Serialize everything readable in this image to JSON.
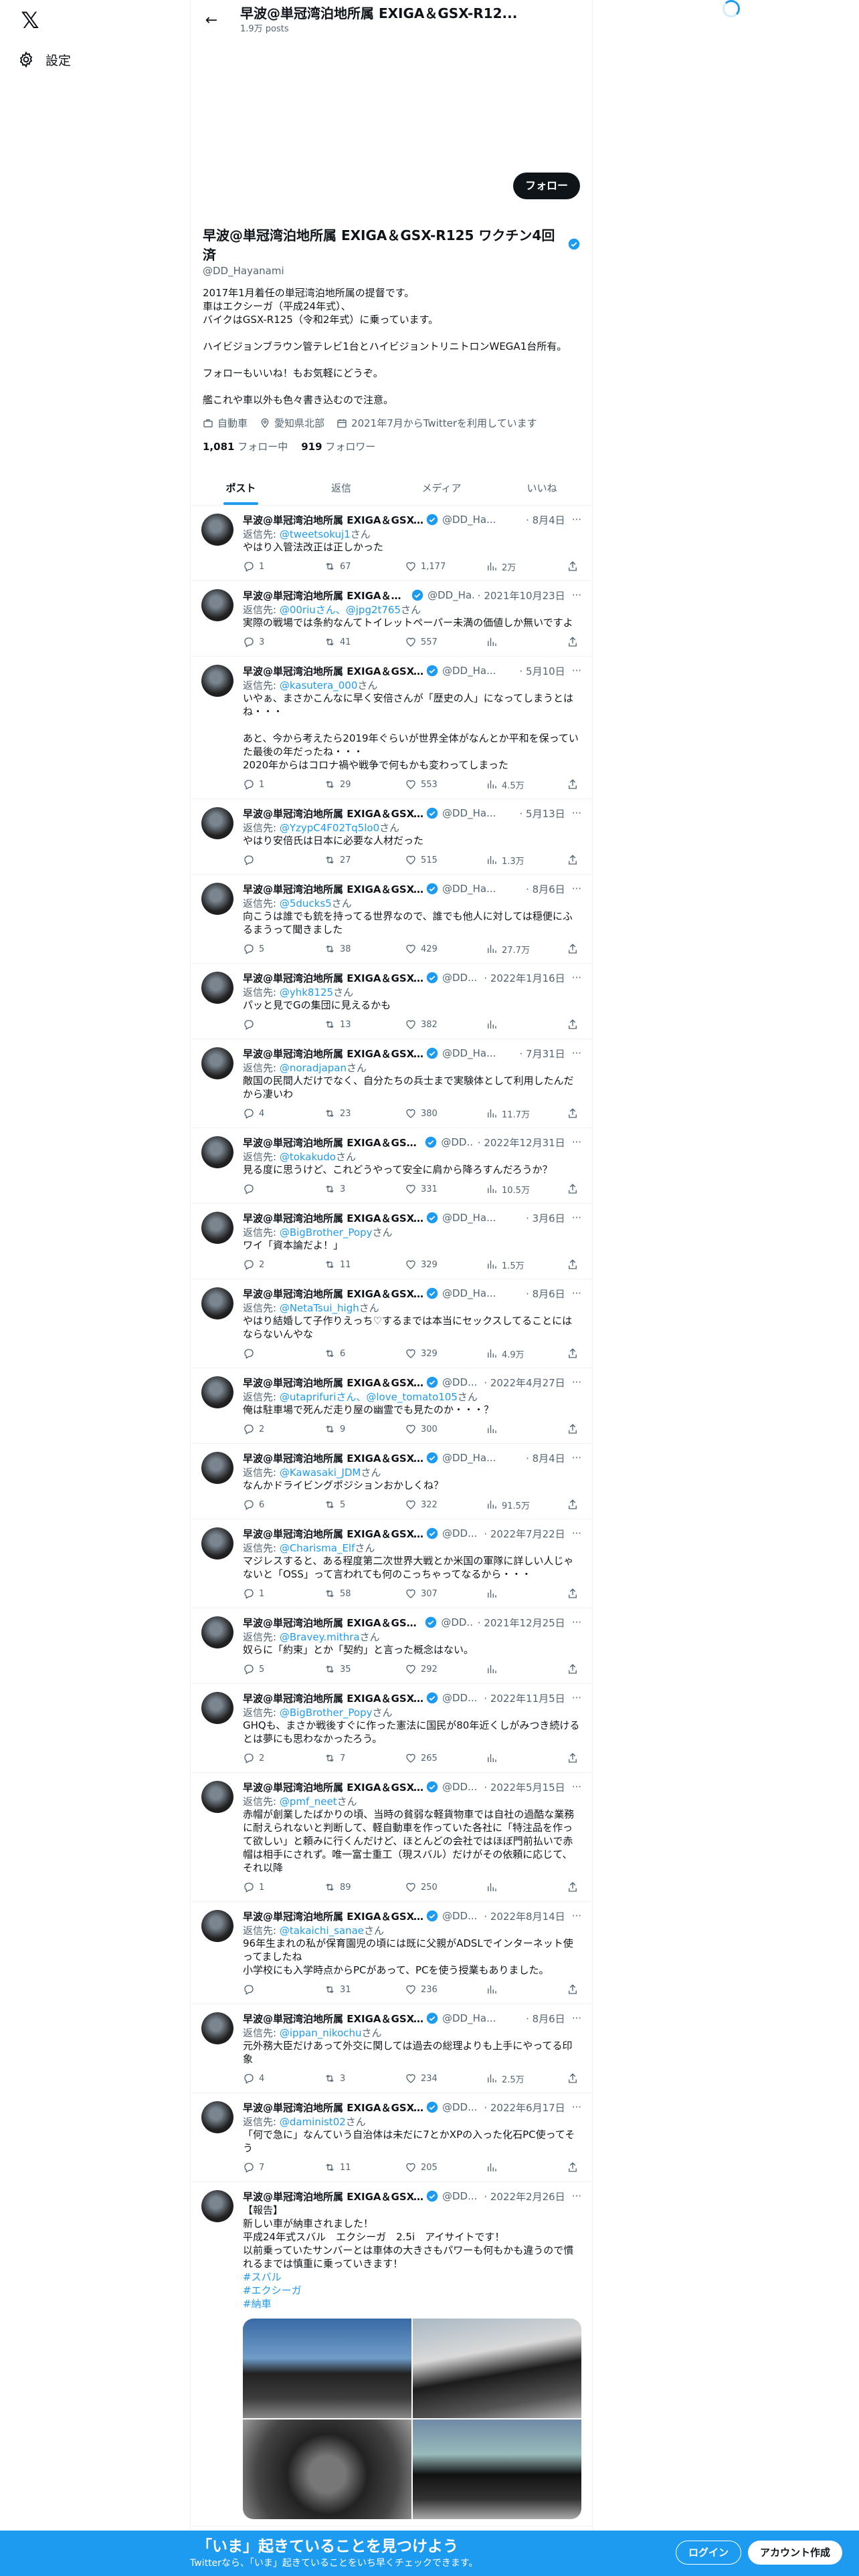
{
  "nav": {
    "settings_label": "設定"
  },
  "header": {
    "title": "早波@単冠湾泊地所属 EXIGA＆GSX-R12...",
    "posts_count": "1.9万 posts"
  },
  "profile": {
    "follow_label": "フォロー",
    "name": "早波@単冠湾泊地所属 EXIGA＆GSX-R125 ワクチン4回済",
    "handle": "@DD_Hayanami",
    "bio": "2017年1月着任の単冠湾泊地所属の提督です。\n車はエクシーガ（平成24年式）、\nバイクはGSX-R125（令和2年式）に乗っています。\n\nハイビジョンブラウン管テレビ1台とハイビジョントリニトロンWEGA1台所有。\n\nフォローもいいね！もお気軽にどうぞ。\n\n艦これや車以外も色々書き込むので注意。",
    "category": "自動車",
    "location": "愛知県北部",
    "joined": "2021年7月からTwitterを利用しています",
    "following_count": "1,081",
    "following_label": "フォロー中",
    "followers_count": "919",
    "followers_label": "フォロワー"
  },
  "tabs": [
    "ポスト",
    "返信",
    "メディア",
    "いいね"
  ],
  "reply_prefix": "返信先: ",
  "reply_suffix": "さん",
  "tweets": [
    {
      "name": "早波@単冠湾泊地所属 EXIGA＆GSX-R125 ...",
      "handle": "@DD_Ha...",
      "date": "· 8月4日",
      "reply_to": "@tweetsokuj1",
      "text": "やはり入管法改正は正しかった",
      "replies": "1",
      "retweets": "67",
      "likes": "1,177",
      "views": "2万"
    },
    {
      "name": "早波@単冠湾泊地所属 EXIGA＆GSX-R...",
      "handle": "@DD_Ha...",
      "date": "· 2021年10月23日",
      "reply_to": "@00riuさん、@jpg2t765",
      "text": "実際の戦場では条約なんてトイレットペーパー未満の価値しか無いですよ",
      "replies": "3",
      "retweets": "41",
      "likes": "557",
      "views": ""
    },
    {
      "name": "早波@単冠湾泊地所属 EXIGA＆GSX-R125 ...",
      "handle": "@DD_Ha...",
      "date": "· 5月10日",
      "reply_to": "@kasutera_000",
      "text": "いやぁ、まさかこんなに早く安倍さんが「歴史の人」になってしまうとはね・・・\n\nあと、今から考えたら2019年ぐらいが世界全体がなんとか平和を保っていた最後の年だったね・・・\n2020年からはコロナ禍や戦争で何もかも変わってしまった",
      "replies": "1",
      "retweets": "29",
      "likes": "553",
      "views": "4.5万"
    },
    {
      "name": "早波@単冠湾泊地所属 EXIGA＆GSX-R125 ...",
      "handle": "@DD_Ha...",
      "date": "· 5月13日",
      "reply_to": "@YzypC4F02Tq5lo0",
      "text": "やはり安倍氏は日本に必要な人材だった",
      "replies": "",
      "retweets": "27",
      "likes": "515",
      "views": "1.3万"
    },
    {
      "name": "早波@単冠湾泊地所属 EXIGA＆GSX-R125 ...",
      "handle": "@DD_Ha...",
      "date": "· 8月6日",
      "reply_to": "@5ducks5",
      "text": "向こうは誰でも銃を持ってる世界なので、誰でも他人に対しては穏便にふるまうって聞きました",
      "replies": "5",
      "retweets": "38",
      "likes": "429",
      "views": "27.7万"
    },
    {
      "name": "早波@単冠湾泊地所属 EXIGA＆GSX-R...",
      "handle": "@DD...",
      "date": "· 2022年1月16日",
      "reply_to": "@yhk8125",
      "text": "パッと見でGの集団に見えるかも",
      "replies": "",
      "retweets": "13",
      "likes": "382",
      "views": ""
    },
    {
      "name": "早波@単冠湾泊地所属 EXIGA＆GSX-R125 ...",
      "handle": "@DD_Ha...",
      "date": "· 7月31日",
      "reply_to": "@noradjapan",
      "text": "敵国の民間人だけでなく、自分たちの兵士まで実験体として利用したんだから凄いわ",
      "replies": "4",
      "retweets": "23",
      "likes": "380",
      "views": "11.7万"
    },
    {
      "name": "早波@単冠湾泊地所属 EXIGA＆GSX-R...",
      "handle": "@DD...",
      "date": "· 2022年12月31日",
      "reply_to": "@tokakudo",
      "text": "見る度に思うけど、これどうやって安全に肩から降ろすんだろうか？",
      "replies": "",
      "retweets": "3",
      "likes": "331",
      "views": "10.5万"
    },
    {
      "name": "早波@単冠湾泊地所属 EXIGA＆GSX-R125 ...",
      "handle": "@DD_Ha...",
      "date": "· 3月6日",
      "reply_to": "@BigBrother_Popy",
      "text": "ワイ「資本論だよ！」",
      "replies": "2",
      "retweets": "11",
      "likes": "329",
      "views": "1.5万"
    },
    {
      "name": "早波@単冠湾泊地所属 EXIGA＆GSX-R125 ...",
      "handle": "@DD_Ha...",
      "date": "· 8月6日",
      "reply_to": "@NetaTsui_high",
      "text": "やはり結婚して子作りえっち♡するまでは本当にセックスしてることにはならないんやな",
      "replies": "",
      "retweets": "6",
      "likes": "329",
      "views": "4.9万"
    },
    {
      "name": "早波@単冠湾泊地所属 EXIGA＆GSX-R...",
      "handle": "@DD...",
      "date": "· 2022年4月27日",
      "reply_to": "@utaprifuriさん、@love_tomato105",
      "text": "俺は駐車場で死んだ走り屋の幽霊でも見たのか・・・？",
      "replies": "2",
      "retweets": "9",
      "likes": "300",
      "views": ""
    },
    {
      "name": "早波@単冠湾泊地所属 EXIGA＆GSX-R125 ...",
      "handle": "@DD_Ha...",
      "date": "· 8月4日",
      "reply_to": "@Kawasaki_JDM",
      "text": "なんかドライビングポジションおかしくね？",
      "replies": "6",
      "retweets": "5",
      "likes": "322",
      "views": "91.5万"
    },
    {
      "name": "早波@単冠湾泊地所属 EXIGA＆GSX-R...",
      "handle": "@DD...",
      "date": "· 2022年7月22日",
      "reply_to": "@Charisma_Elf",
      "text": "マジレスすると、ある程度第二次世界大戦とか米国の軍隊に詳しい人じゃないと「OSS」って言われても何のこっちゃってなるから・・・",
      "replies": "1",
      "retweets": "58",
      "likes": "307",
      "views": ""
    },
    {
      "name": "早波@単冠湾泊地所属 EXIGA＆GSX-R...",
      "handle": "@DD...",
      "date": "· 2021年12月25日",
      "reply_to": "@Bravey.mithra",
      "text": "奴らに「約束」とか「契約」と言った概念はない。",
      "replies": "5",
      "retweets": "35",
      "likes": "292",
      "views": ""
    },
    {
      "name": "早波@単冠湾泊地所属 EXIGA＆GSX-R...",
      "handle": "@DD...",
      "date": "· 2022年11月5日",
      "reply_to": "@BigBrother_Popy",
      "text": "GHQも、まさか戦後すぐに作った憲法に国民が80年近くしがみつき続けるとは夢にも思わなかったろう。",
      "replies": "2",
      "retweets": "7",
      "likes": "265",
      "views": ""
    },
    {
      "name": "早波@単冠湾泊地所属 EXIGA＆GSX-R...",
      "handle": "@DD...",
      "date": "· 2022年5月15日",
      "reply_to": "@pmf_neet",
      "text": "赤帽が創業したばかりの頃、当時の貧弱な軽貨物車では自社の過酷な業務に耐えられないと判断して、軽自動車を作っていた各社に「特注品を作って欲しい」と頼みに行くんだけど、ほとんどの会社ではほぼ門前払いで赤帽は相手にされず。唯一富士重工（現スバル）だけがその依頼に応じて、それ以降",
      "replies": "1",
      "retweets": "89",
      "likes": "250",
      "views": ""
    },
    {
      "name": "早波@単冠湾泊地所属 EXIGA＆GSX-R...",
      "handle": "@DD...",
      "date": "· 2022年8月14日",
      "reply_to": "@takaichi_sanae",
      "text": "96年生まれの私が保育園児の頃には既に父親がADSLでインターネット使ってましたね\n小学校にも入学時点からPCがあって、PCを使う授業もありました。",
      "replies": "",
      "retweets": "31",
      "likes": "236",
      "views": ""
    },
    {
      "name": "早波@単冠湾泊地所属 EXIGA＆GSX-R125 ...",
      "handle": "@DD_Ha...",
      "date": "· 8月6日",
      "reply_to": "@ippan_nikochu",
      "text": "元外務大臣だけあって外交に関しては過去の総理よりも上手にやってる印象",
      "replies": "4",
      "retweets": "3",
      "likes": "234",
      "views": "2.5万"
    },
    {
      "name": "早波@単冠湾泊地所属 EXIGA＆GSX-R...",
      "handle": "@DD...",
      "date": "· 2022年6月17日",
      "reply_to": "@daminist02",
      "text": "「何で急に」なんていう自治体は未だに7とかXPの入った化石PC使ってそう",
      "replies": "7",
      "retweets": "11",
      "likes": "205",
      "views": ""
    },
    {
      "name": "早波@単冠湾泊地所属 EXIGA＆GSX-R...",
      "handle": "@DD...",
      "date": "· 2022年2月26日",
      "reply_to": "",
      "text": "【報告】\n新しい車が納車されました！\n平成24年式スバル　エクシーガ　2.5i　アイサイトです！\n以前乗っていたサンバーとは車体の大きさもパワーも何もかも違うので慣れるまでは慎重に乗っていきます！",
      "hashtags": [
        "#スバル",
        "#エクシーガ",
        "#納車"
      ],
      "has_media": true
    }
  ],
  "bottom_bar": {
    "title": "「いま」起きていることを見つけよう",
    "subtitle": "Twitterなら、「いま」起きていることをいち早くチェックできます。",
    "login_label": "ログイン",
    "signup_label": "アカウント作成"
  },
  "colors": {
    "accent": "#1d9bf0",
    "text": "#0f1419",
    "muted": "#536471"
  }
}
